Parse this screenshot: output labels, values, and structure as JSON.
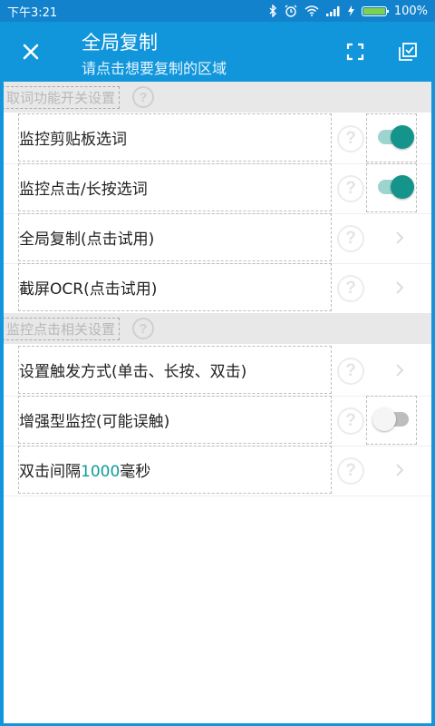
{
  "status_bar": {
    "time": "下午3:21",
    "battery_percent": "100%",
    "battery_level": 1.0
  },
  "app_bar": {
    "title": "全局复制",
    "subtitle": "请点击想要复制的区域",
    "close_icon": "close-icon",
    "fullscreen_icon": "fullscreen-icon",
    "copy_all_icon": "copy-all-icon"
  },
  "sections": [
    {
      "title": "取词功能开关设置",
      "items": [
        {
          "label": "监控剪贴板选词",
          "control": "switch",
          "on": true
        },
        {
          "label": "监控点击/长按选词",
          "control": "switch",
          "on": true
        },
        {
          "label": "全局复制(点击试用)",
          "control": "chevron"
        },
        {
          "label": "截屏OCR(点击试用)",
          "control": "chevron"
        }
      ]
    },
    {
      "title": "监控点击相关设置",
      "items": [
        {
          "label": "设置触发方式(单击、长按、双击)",
          "control": "chevron"
        },
        {
          "label": "增强型监控(可能误触)",
          "control": "switch",
          "on": false
        },
        {
          "label_prefix": "双击间隔",
          "label_value": "1000",
          "label_suffix": "毫秒",
          "control": "chevron"
        }
      ]
    }
  ],
  "colors": {
    "primary": "#1296db",
    "status_bar": "#1282cc",
    "switch_on": "#14948a",
    "accent_value": "#119a9a"
  }
}
